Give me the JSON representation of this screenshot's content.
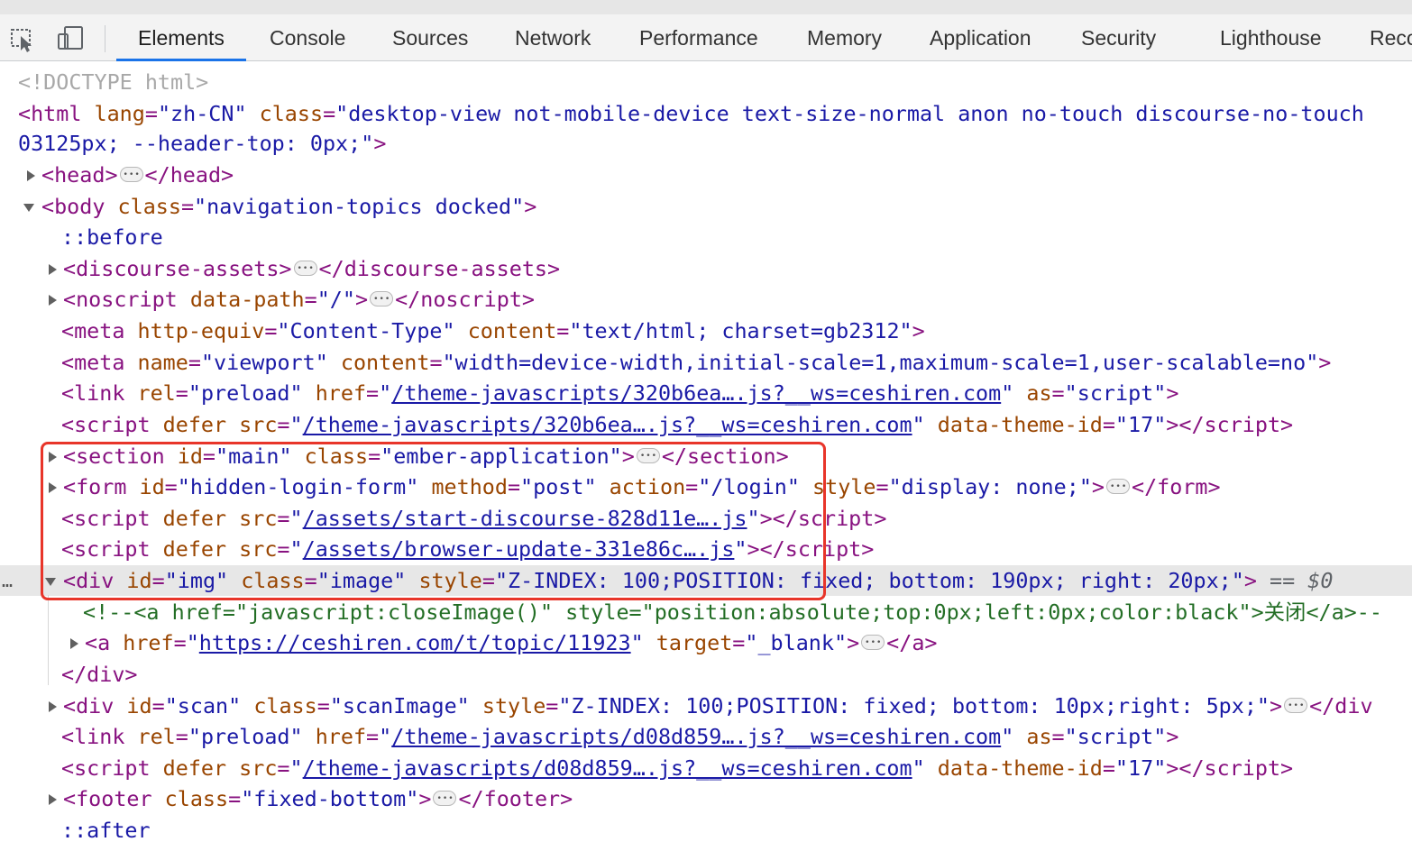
{
  "toolbar": {
    "inspect_icon": "inspect-element-icon",
    "device_icon": "device-toggle-icon",
    "tabs": [
      {
        "label": "Elements",
        "active": true
      },
      {
        "label": "Console"
      },
      {
        "label": "Sources"
      },
      {
        "label": "Network"
      },
      {
        "label": "Performance"
      },
      {
        "label": "Memory"
      },
      {
        "label": "Application"
      },
      {
        "label": "Security"
      },
      {
        "label": "Lighthouse"
      },
      {
        "label": "Reco"
      }
    ]
  },
  "dom_tree": {
    "doctype": "<!DOCTYPE html>",
    "html_open": {
      "lang": "zh-CN",
      "class": "desktop-view not-mobile-device text-size-normal anon no-touch discourse-no-touch",
      "style_tail": "03125px; --header-top: 0px;"
    },
    "head": {
      "tag": "head"
    },
    "body": {
      "tag": "body",
      "class": "navigation-topics docked"
    },
    "before": "::before",
    "discourse_assets": {
      "tag": "discourse-assets"
    },
    "noscript": {
      "tag": "noscript",
      "attr": "data-path",
      "value": "/"
    },
    "meta1": {
      "http_equiv": "Content-Type",
      "content": "text/html; charset=gb2312"
    },
    "meta2": {
      "name": "viewport",
      "content": "width=device-width,initial-scale=1,maximum-scale=1,user-scalable=no"
    },
    "link1": {
      "rel": "preload",
      "href": "/theme-javascripts/320b6ea….js?__ws=ceshiren.com",
      "as": "script"
    },
    "script1": {
      "src": "/theme-javascripts/320b6ea….js?__ws=ceshiren.com",
      "theme_id": "17"
    },
    "section": {
      "id": "main",
      "class": "ember-application"
    },
    "form": {
      "id": "hidden-login-form",
      "method": "post",
      "action": "/login",
      "style": "display: none;"
    },
    "script2": {
      "src": "/assets/start-discourse-828d11e….js"
    },
    "script3": {
      "src": "/assets/browser-update-331e86c….js"
    },
    "div_img": {
      "id": "img",
      "class": "image",
      "style": "Z-INDEX: 100;POSITION: fixed; bottom: 190px; right: 20px;",
      "selected_marker": "== $0"
    },
    "comment": "<!--<a href=\"javascript:closeImage()\" style=\"position:absolute;top:0px;left:0px;color:black\">关闭</a>--",
    "anchor": {
      "href": "https://ceshiren.com/t/topic/11923",
      "target": "_blank"
    },
    "div_close": "</div>",
    "div_scan": {
      "id": "scan",
      "class": "scanImage",
      "style": "Z-INDEX: 100;POSITION: fixed; bottom: 10px;right: 5px;"
    },
    "link2": {
      "rel": "preload",
      "href": "/theme-javascripts/d08d859….js?__ws=ceshiren.com",
      "as": "script"
    },
    "script4": {
      "src": "/theme-javascripts/d08d859….js?__ws=ceshiren.com",
      "theme_id": "17"
    },
    "footer": {
      "class": "fixed-bottom"
    },
    "after": "::after",
    "left_gutter_dots": "…"
  },
  "colors": {
    "tag": "#881280",
    "attr_name": "#994500",
    "attr_value": "#1a1aa6",
    "comment": "#236e25",
    "highlight_box": "#e8352a",
    "active_tab_underline": "#1a73e8",
    "selected_row": "#e7e7e7"
  }
}
